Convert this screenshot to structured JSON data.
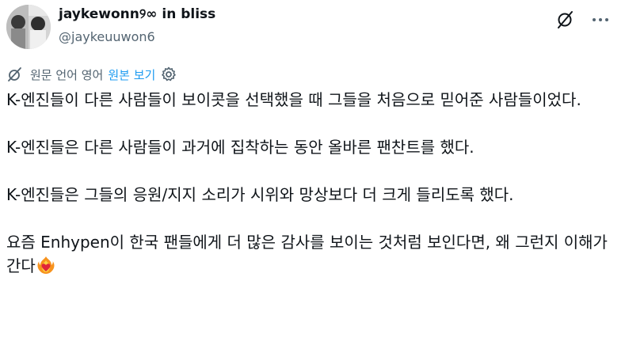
{
  "user": {
    "display_name": "jaykewonn୨∞ in bliss",
    "handle": "@jaykeuuwon6"
  },
  "icons": {
    "grok": "grok-icon",
    "more": "more-options-icon",
    "translate": "translate-icon",
    "settings": "settings-gear-icon",
    "emoji": "heart-on-fire-emoji-icon"
  },
  "translation": {
    "label": "원문 언어 영어",
    "show_original": "원본 보기"
  },
  "tweet": {
    "p1": "K-엔진들이 다른 사람들이 보이콧을 선택했을 때 그들을 처음으로 믿어준 사람들이었다.",
    "p2": "K-엔진들은 다른 사람들이 과거에 집착하는 동안 올바른 팬찬트를 했다.",
    "p3": "K-엔진들은 그들의 응원/지지 소리가 시위와 망상보다 더 크게 들리도록 했다.",
    "p4": "요즘 Enhypen이 한국 팬들에게 더 많은 감사를 보이는 것처럼 보인다면, 왜 그런지 이해가 간다"
  },
  "colors": {
    "text": "#0f1419",
    "secondary": "#536471",
    "link": "#1d9bf0"
  }
}
